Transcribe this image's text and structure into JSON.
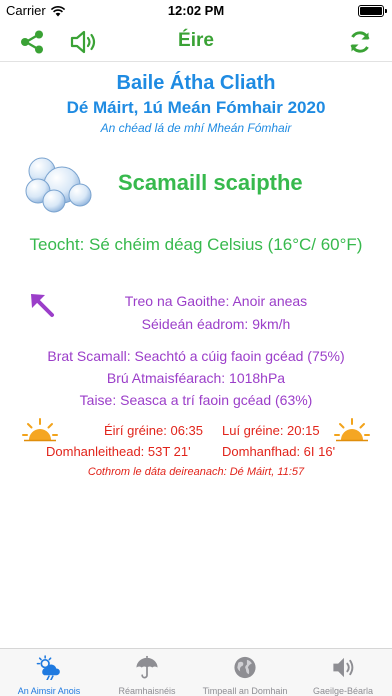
{
  "status_bar": {
    "carrier": "Carrier",
    "time": "12:02 PM"
  },
  "nav": {
    "title": "Éire"
  },
  "location": {
    "city": "Baile Átha Cliath",
    "date": "Dé Máirt, 1ú Meán Fómhair 2020",
    "day_note": "An chéad lá de mhí Mheán Fómhair"
  },
  "weather": {
    "condition": "Scamaill scaipthe",
    "temperature": "Teocht: Sé chéim déag Celsius (16°C/ 60°F)",
    "wind_direction": "Treo na Gaoithe: Anoir aneas",
    "wind_speed": "Séideán éadrom: 9km/h",
    "cloud_cover": "Brat Scamall: Seachtó a cúig faoin gcéad (75%)",
    "pressure": "Brú Atmaisféarach: 1018hPa",
    "humidity": "Taise: Seasca a trí faoin gcéad (63%)"
  },
  "sun": {
    "sunrise": "Éirí gréine: 06:35",
    "sunset": "Luí gréine: 20:15",
    "latitude": "Domhanleithead: 53T 21'",
    "longitude": "Domhanfhad: 6I 16'"
  },
  "updated": "Cothrom le dáta deireanach: Dé Máirt, 11:57",
  "tabs": [
    {
      "label": "An Aimsir Anois",
      "icon": "weather-now-icon",
      "active": true
    },
    {
      "label": "Réamhaisnéis",
      "icon": "umbrella-icon",
      "active": false
    },
    {
      "label": "Timpeall an Domhain",
      "icon": "globe-icon",
      "active": false
    },
    {
      "label": "Gaeilge-Béarla",
      "icon": "speaker-icon",
      "active": false
    }
  ],
  "colors": {
    "accent_green": "#3aa235",
    "blue": "#1f8be2",
    "purple": "#9b3ec9",
    "red": "#e1241b",
    "tab_active": "#1f7ae0"
  }
}
